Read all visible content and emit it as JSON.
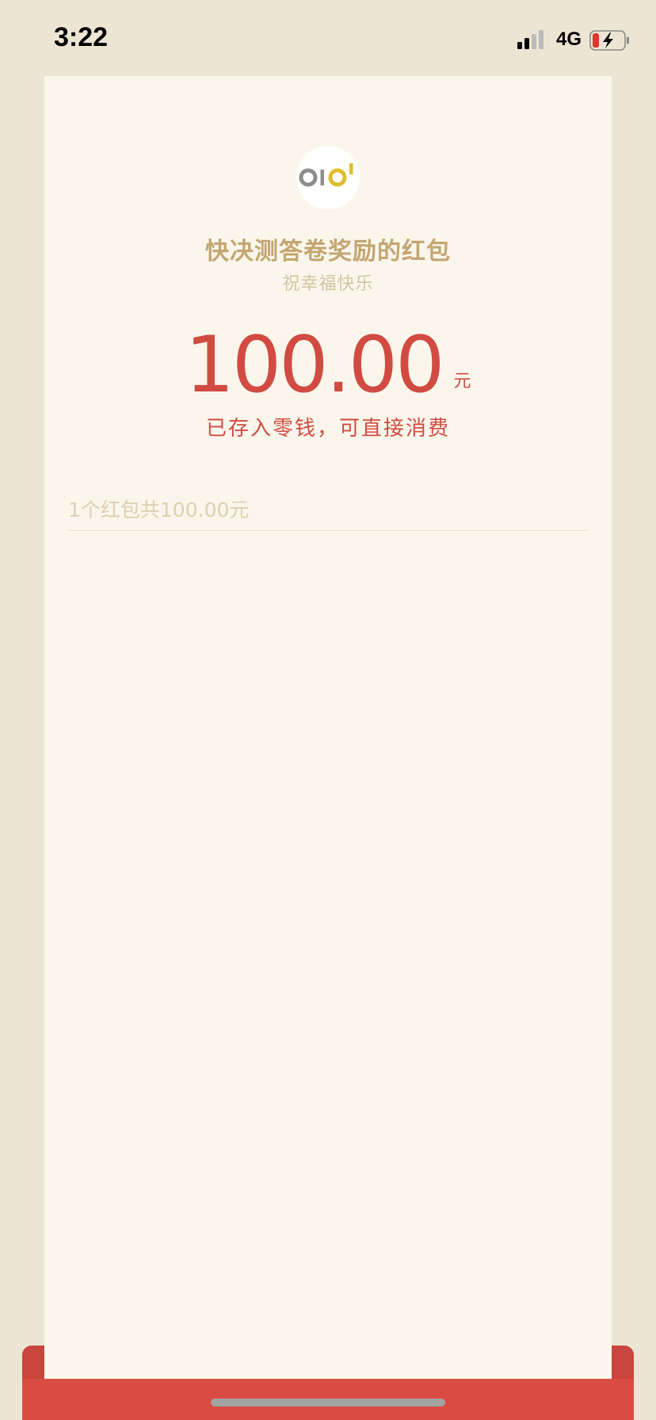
{
  "status_bar": {
    "time": "3:22",
    "network": "4G",
    "battery_level": 0.15,
    "charging": true
  },
  "red_packet": {
    "sender": "快决测答卷奖励的红包",
    "wish": "祝幸福快乐",
    "amount": "100.00",
    "unit": "元",
    "deposit_note": "已存入零钱，可直接消费",
    "summary": "1个红包共100.00元"
  },
  "colors": {
    "background": "#ede5d4",
    "card": "#faf6eb",
    "amount_red": "#d14b42",
    "sender_gold": "#c3a672",
    "bottom_red": "#d94c44"
  }
}
